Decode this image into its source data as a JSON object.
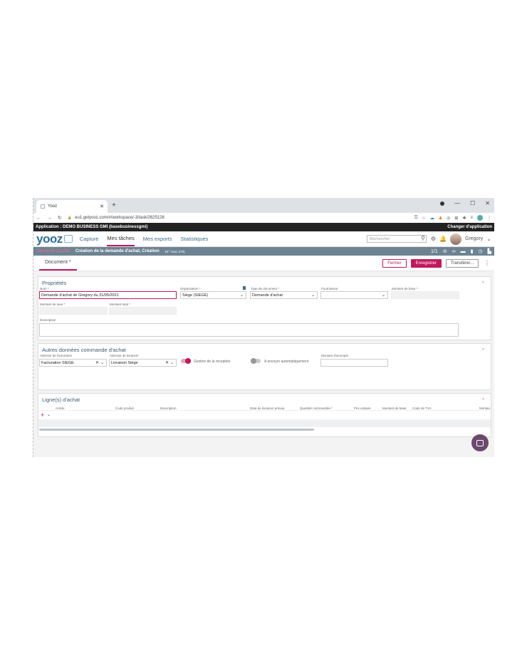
{
  "browser": {
    "tab_title": "Yooz",
    "url": "eu1.getyooz.com/#/workspace/-3/task/2625128"
  },
  "app": {
    "application_label": "Application : DEMO BUSINESS GMI (basebusinessgmi)",
    "change_app_label": "Changer d'application"
  },
  "nav": {
    "logo": "yooz",
    "items": [
      "Capture",
      "Mes tâches",
      "Mes exports",
      "Statistiques"
    ],
    "search_placeholder": "Rechercher",
    "user": "Gregory"
  },
  "subbar": {
    "crumb": "Demande d'achat",
    "title": "Création de la demande d'achat, Création",
    "number": "(N° Yooz 270)",
    "pager": "1/1"
  },
  "toolbar": {
    "doc_tab": "Document *",
    "close": "Fermer",
    "save": "Enregistrer",
    "transfer": "Transférer..."
  },
  "props": {
    "title": "Propriétés",
    "nom_label": "Nom *",
    "nom_value": "Demande d'achat de Gregory du 31/05/2021",
    "org_label": "Organisation *",
    "org_value": "Siège (SIEGE)",
    "type_label": "Type de document *",
    "type_value": "Demande d'achat",
    "fournisseur_label": "Fournisseur",
    "montant_base_label": "Montant de base *",
    "montant_taxe_label": "Montant de taxe *",
    "montant_total_label": "Montant total *",
    "description_label": "Description"
  },
  "autres": {
    "title": "Autres données commande d'achat",
    "facturation_label": "Adresse de facturation",
    "facturation_value": "Facturation SIEGE",
    "livraison_label": "Adresse de livraison",
    "livraison_value": "Livraison Siège",
    "gestion_label": "Gestion de la réception",
    "envoyer_label": "A envoyer automatiquement",
    "acompte_label": "Montant d'acompte"
  },
  "lignes": {
    "title": "Ligne(s) d'achat",
    "headers": [
      "Article",
      "Code produit",
      "Description",
      "Date de livraison prévue",
      "Quantité commandée *",
      "Prix unitaire",
      "Montant de base",
      "Code de TVA",
      "Montan"
    ]
  },
  "colors": {
    "accent": "#c2185b",
    "subbar": "#6d8391"
  }
}
